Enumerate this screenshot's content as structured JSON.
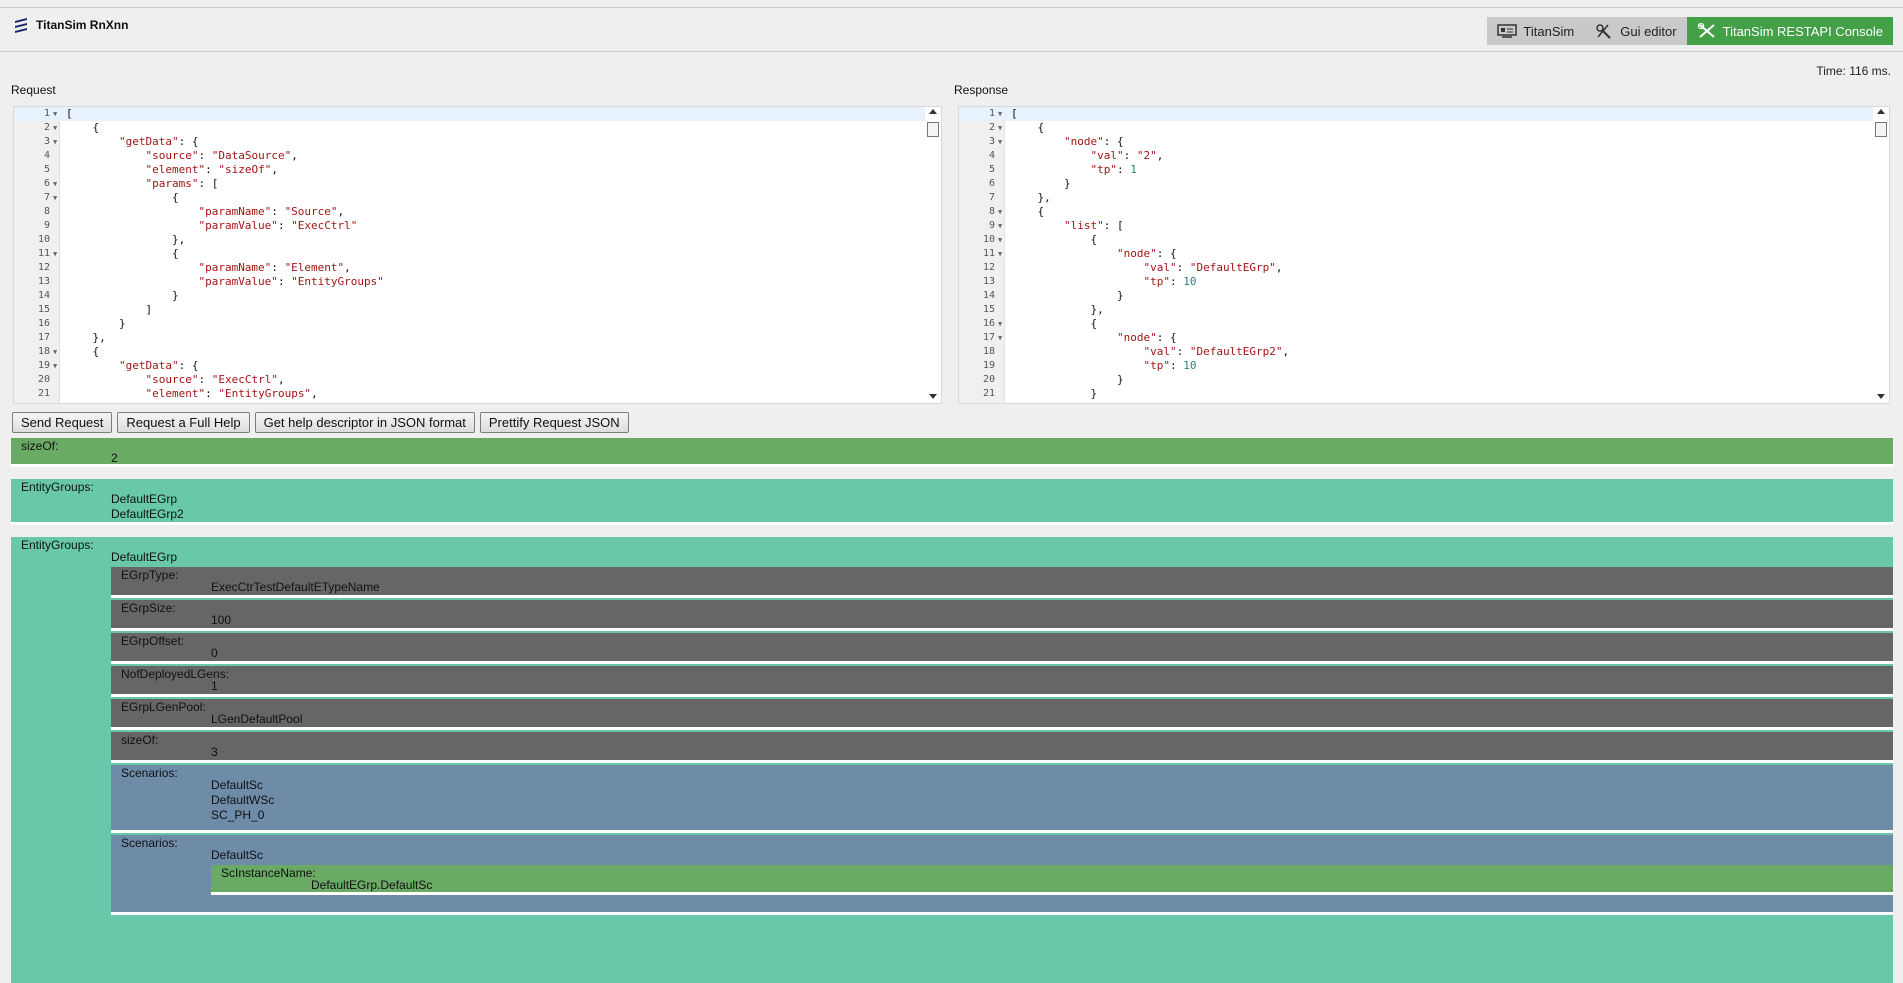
{
  "app": {
    "title": "TitanSim RnXnn"
  },
  "nav": {
    "titansim": "TitanSim",
    "gui_editor": "Gui editor",
    "console": "TitanSim RESTAPI Console"
  },
  "status": {
    "time": "Time: 116 ms."
  },
  "labels": {
    "request": "Request",
    "response": "Response"
  },
  "request_lines": [
    {
      "n": "1",
      "f": true,
      "c": "["
    },
    {
      "n": "2",
      "f": true,
      "c": "    {"
    },
    {
      "n": "3",
      "f": true,
      "c": "        \"getData\": {"
    },
    {
      "n": "4",
      "f": false,
      "c": "            \"source\": \"DataSource\","
    },
    {
      "n": "5",
      "f": false,
      "c": "            \"element\": \"sizeOf\","
    },
    {
      "n": "6",
      "f": true,
      "c": "            \"params\": ["
    },
    {
      "n": "7",
      "f": true,
      "c": "                {"
    },
    {
      "n": "8",
      "f": false,
      "c": "                    \"paramName\": \"Source\","
    },
    {
      "n": "9",
      "f": false,
      "c": "                    \"paramValue\": \"ExecCtrl\""
    },
    {
      "n": "10",
      "f": false,
      "c": "                },"
    },
    {
      "n": "11",
      "f": true,
      "c": "                {"
    },
    {
      "n": "12",
      "f": false,
      "c": "                    \"paramName\": \"Element\","
    },
    {
      "n": "13",
      "f": false,
      "c": "                    \"paramValue\": \"EntityGroups\""
    },
    {
      "n": "14",
      "f": false,
      "c": "                }"
    },
    {
      "n": "15",
      "f": false,
      "c": "            ]"
    },
    {
      "n": "16",
      "f": false,
      "c": "        }"
    },
    {
      "n": "17",
      "f": false,
      "c": "    },"
    },
    {
      "n": "18",
      "f": true,
      "c": "    {"
    },
    {
      "n": "19",
      "f": true,
      "c": "        \"getData\": {"
    },
    {
      "n": "20",
      "f": false,
      "c": "            \"source\": \"ExecCtrl\","
    },
    {
      "n": "21",
      "f": false,
      "c": "            \"element\": \"EntityGroups\","
    }
  ],
  "response_lines": [
    {
      "n": "1",
      "f": true,
      "c": "["
    },
    {
      "n": "2",
      "f": true,
      "c": "    {"
    },
    {
      "n": "3",
      "f": true,
      "c": "        \"node\": {"
    },
    {
      "n": "4",
      "f": false,
      "c": "            \"val\": \"2\","
    },
    {
      "n": "5",
      "f": false,
      "c": "            \"tp\": 1"
    },
    {
      "n": "6",
      "f": false,
      "c": "        }"
    },
    {
      "n": "7",
      "f": false,
      "c": "    },"
    },
    {
      "n": "8",
      "f": true,
      "c": "    {"
    },
    {
      "n": "9",
      "f": true,
      "c": "        \"list\": ["
    },
    {
      "n": "10",
      "f": true,
      "c": "            {"
    },
    {
      "n": "11",
      "f": true,
      "c": "                \"node\": {"
    },
    {
      "n": "12",
      "f": false,
      "c": "                    \"val\": \"DefaultEGrp\","
    },
    {
      "n": "13",
      "f": false,
      "c": "                    \"tp\": 10"
    },
    {
      "n": "14",
      "f": false,
      "c": "                }"
    },
    {
      "n": "15",
      "f": false,
      "c": "            },"
    },
    {
      "n": "16",
      "f": true,
      "c": "            {"
    },
    {
      "n": "17",
      "f": true,
      "c": "                \"node\": {"
    },
    {
      "n": "18",
      "f": false,
      "c": "                    \"val\": \"DefaultEGrp2\","
    },
    {
      "n": "19",
      "f": false,
      "c": "                    \"tp\": 10"
    },
    {
      "n": "20",
      "f": false,
      "c": "                }"
    },
    {
      "n": "21",
      "f": false,
      "c": "            }"
    }
  ],
  "buttons": {
    "send": "Send Request",
    "full_help": "Request a Full Help",
    "help_json": "Get help descriptor in JSON format",
    "prettify": "Prettify Request JSON"
  },
  "results": {
    "sizeof_block": {
      "title": "sizeOf:",
      "value": "2"
    },
    "egroups_block": {
      "title": "EntityGroups:",
      "values": [
        "DefaultEGrp",
        "DefaultEGrp2"
      ]
    },
    "egroups_detail": {
      "title": "EntityGroups:",
      "value": "DefaultEGrp",
      "items": [
        {
          "title": "EGrpType:",
          "value": "ExecCtrTestDefaultETypeName"
        },
        {
          "title": "EGrpSize:",
          "value": "100"
        },
        {
          "title": "EGrpOffset:",
          "value": "0"
        },
        {
          "title": "NofDeployedLGens:",
          "value": "1"
        },
        {
          "title": "EGrpLGenPool:",
          "value": "LGenDefaultPool"
        },
        {
          "title": "sizeOf:",
          "value": "3"
        }
      ],
      "scenarios": {
        "title": "Scenarios:",
        "values": [
          "DefaultSc",
          "DefaultWSc",
          "SC_PH_0"
        ]
      },
      "scenarios2": {
        "title": "Scenarios:",
        "value": "DefaultSc",
        "instance": {
          "title": "ScInstanceName:",
          "value": "DefaultEGrp.DefaultSc"
        }
      }
    }
  }
}
